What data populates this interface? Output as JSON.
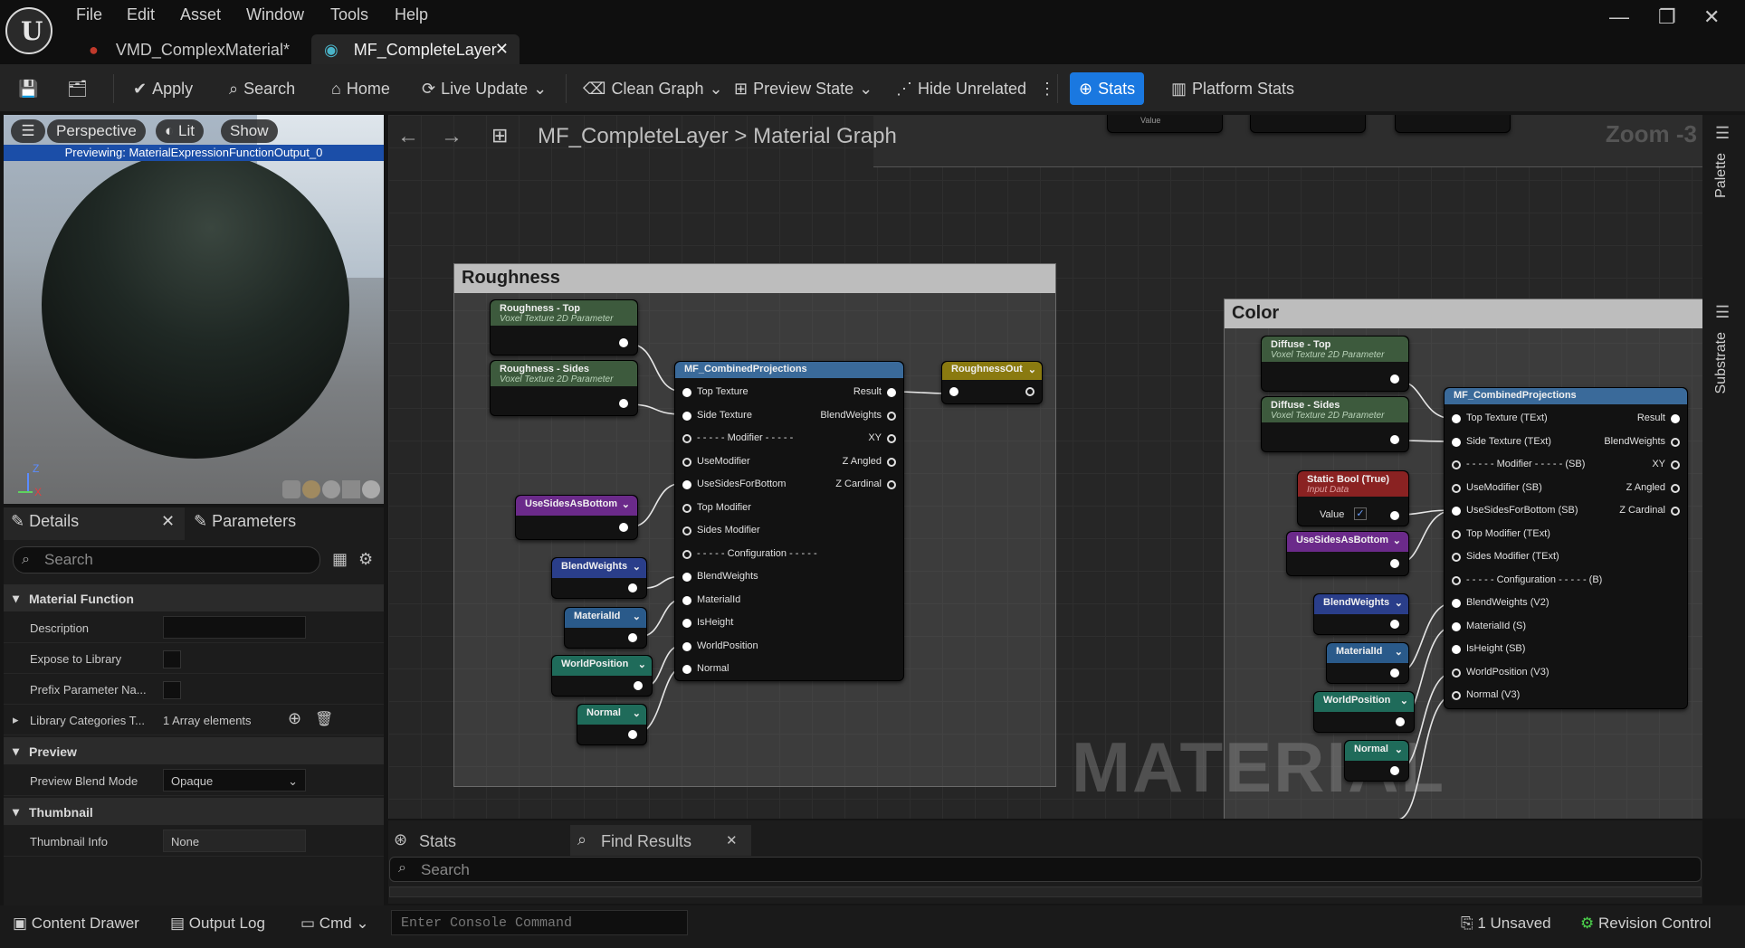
{
  "menu": [
    "File",
    "Edit",
    "Asset",
    "Window",
    "Tools",
    "Help"
  ],
  "tabs": [
    {
      "label": "VMD_ComplexMaterial*"
    },
    {
      "label": "MF_CompleteLayer"
    }
  ],
  "toolbar": {
    "apply": "Apply",
    "search": "Search",
    "home": "Home",
    "live_update": "Live Update",
    "clean_graph": "Clean Graph",
    "preview_state": "Preview State",
    "hide_unrelated": "Hide Unrelated",
    "stats": "Stats",
    "platform_stats": "Platform Stats"
  },
  "viewport": {
    "perspective": "Perspective",
    "lit": "Lit",
    "show": "Show",
    "previewing": "Previewing: MaterialExpressionFunctionOutput_0",
    "axis_z": "Z",
    "axis_x": "X"
  },
  "details": {
    "tab_details": "Details",
    "tab_parameters": "Parameters",
    "search_placeholder": "Search",
    "sections": {
      "material_function": "Material Function",
      "preview": "Preview",
      "thumbnail": "Thumbnail"
    },
    "rows": {
      "description": "Description",
      "expose": "Expose to Library",
      "prefix": "Prefix Parameter Na...",
      "library_categories": "Library Categories T...",
      "library_categories_value": "1 Array elements",
      "preview_blend_mode": "Preview Blend Mode",
      "preview_blend_mode_value": "Opaque",
      "thumbnail_info": "Thumbnail Info",
      "thumbnail_info_value": "None"
    }
  },
  "graph": {
    "breadcrumb_root": "MF_CompleteLayer",
    "breadcrumb_sep": ">",
    "breadcrumb_leaf": "Material Graph",
    "zoom": "Zoom -3",
    "watermark": "MATERIAL FUNCTION",
    "top_node_value": "Value",
    "roughness": {
      "title": "Roughness",
      "top": {
        "title": "Roughness - Top",
        "sub": "Voxel Texture 2D Parameter"
      },
      "sides": {
        "title": "Roughness - Sides",
        "sub": "Voxel Texture 2D Parameter"
      },
      "use_sides": "UseSidesAsBottom",
      "blend_weights": "BlendWeights",
      "material_id": "MaterialId",
      "world_position": "WorldPosition",
      "normal": "Normal",
      "combined": "MF_CombinedProjections",
      "inputs": [
        "Top Texture",
        "Side Texture",
        "- - - - - Modifier - - - - -",
        "UseModifier",
        "UseSidesForBottom",
        "Top Modifier",
        "Sides Modifier",
        "- - - - - Configuration - - - - -",
        "BlendWeights",
        "MaterialId",
        "IsHeight",
        "WorldPosition",
        "Normal"
      ],
      "outputs": [
        "Result",
        "BlendWeights",
        "XY",
        "Z Angled",
        "Z Cardinal"
      ],
      "output_node": "RoughnessOut"
    },
    "color": {
      "title": "Color",
      "top": {
        "title": "Diffuse - Top",
        "sub": "Voxel Texture 2D Parameter"
      },
      "sides": {
        "title": "Diffuse - Sides",
        "sub": "Voxel Texture 2D Parameter"
      },
      "static_bool": {
        "title": "Static Bool (True)",
        "sub": "Input Data",
        "value": "Value"
      },
      "use_sides": "UseSidesAsBottom",
      "blend_weights": "BlendWeights",
      "material_id": "MaterialId",
      "world_position": "WorldPosition",
      "normal": "Normal",
      "combined": "MF_CombinedProjections",
      "inputs": [
        "Top Texture (TExt)",
        "Side Texture (TExt)",
        "- - - - - Modifier - - - - - (SB)",
        "UseModifier (SB)",
        "UseSidesForBottom (SB)",
        "Top Modifier (TExt)",
        "Sides Modifier (TExt)",
        "- - - - - Configuration - - - - - (B)",
        "BlendWeights (V2)",
        "MaterialId (S)",
        "IsHeight (SB)",
        "WorldPosition (V3)",
        "Normal (V3)"
      ],
      "outputs": [
        "Result",
        "BlendWeights",
        "XY",
        "Z Angled",
        "Z Cardinal"
      ]
    }
  },
  "side": {
    "palette": "Palette",
    "substrate": "Substrate"
  },
  "bottom": {
    "stats_tab": "Stats",
    "find_tab": "Find Results",
    "search_placeholder": "Search"
  },
  "status": {
    "content_drawer": "Content Drawer",
    "output_log": "Output Log",
    "cmd": "Cmd",
    "console_placeholder": "Enter Console Command",
    "unsaved": "1 Unsaved",
    "revision": "Revision Control"
  },
  "colors": {
    "accent": "#1a78e0",
    "texture_node": "#3d5a3d",
    "purple_node": "#6b2a8a",
    "blue_node": "#2a3e8a",
    "teal_node": "#1f6b5a",
    "yellow_node": "#8a7a10",
    "red_node": "#8a2222"
  }
}
